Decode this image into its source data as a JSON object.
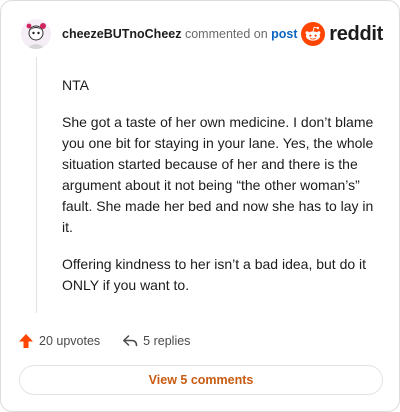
{
  "header": {
    "username": "cheezeBUTnoCheez",
    "verb": "commented on",
    "post_link": "post",
    "brand": "reddit"
  },
  "comment": {
    "paragraphs": [
      "NTA",
      "She got a taste of her own medicine. I don’t blame you one bit for staying in your lane. Yes, the whole situation started because of her and there is the argument about it not being “the other woman’s” fault. She made her bed and now she has to lay in it.",
      "Offering kindness to her isn’t a bad idea, but do it ONLY if you want to."
    ]
  },
  "actions": {
    "upvotes": "20 upvotes",
    "replies": "5 replies"
  },
  "footer": {
    "view_comments": "View 5 comments"
  },
  "colors": {
    "upvote": "#ff4500",
    "reddit_orange": "#ff4500",
    "link_blue": "#0a66c2",
    "view_button_text": "#c75b12"
  },
  "icons": [
    "avatar",
    "reddit-snoo-icon",
    "upvote-arrow-icon",
    "reply-icon"
  ]
}
